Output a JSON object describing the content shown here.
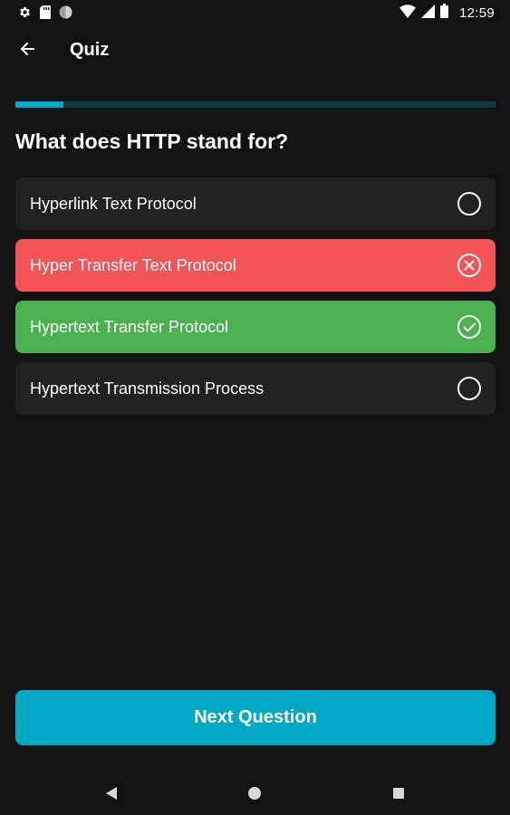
{
  "status_bar": {
    "time": "12:59",
    "left_icons": [
      "gear-icon",
      "sd-card-icon",
      "circle-icon"
    ],
    "right_icons": [
      "wifi-icon",
      "signal-icon",
      "battery-icon"
    ]
  },
  "app_bar": {
    "title": "Quiz",
    "back_icon": "arrow-back-icon"
  },
  "progress": {
    "fraction": 0.1,
    "track_color": "#0d3b44",
    "fill_color": "#00a8c4"
  },
  "question": {
    "text": "What does HTTP stand for?"
  },
  "options": [
    {
      "label": "Hyperlink Text Protocol",
      "state": "unselected",
      "icon": "radio-empty-icon"
    },
    {
      "label": "Hyper Transfer Text Protocol",
      "state": "wrong",
      "icon": "x-circle-icon"
    },
    {
      "label": "Hypertext Transfer Protocol",
      "state": "correct",
      "icon": "check-circle-icon"
    },
    {
      "label": "Hypertext Transmission Process",
      "state": "unselected",
      "icon": "radio-empty-icon"
    }
  ],
  "colors": {
    "background": "#121212",
    "option_default": "#212121",
    "wrong": "#f25457",
    "correct": "#4caf50",
    "accent": "#00a8c4"
  },
  "next_button": {
    "label": "Next Question"
  },
  "nav_bar": {
    "icons": [
      "nav-back-icon",
      "nav-home-icon",
      "nav-recents-icon"
    ]
  }
}
